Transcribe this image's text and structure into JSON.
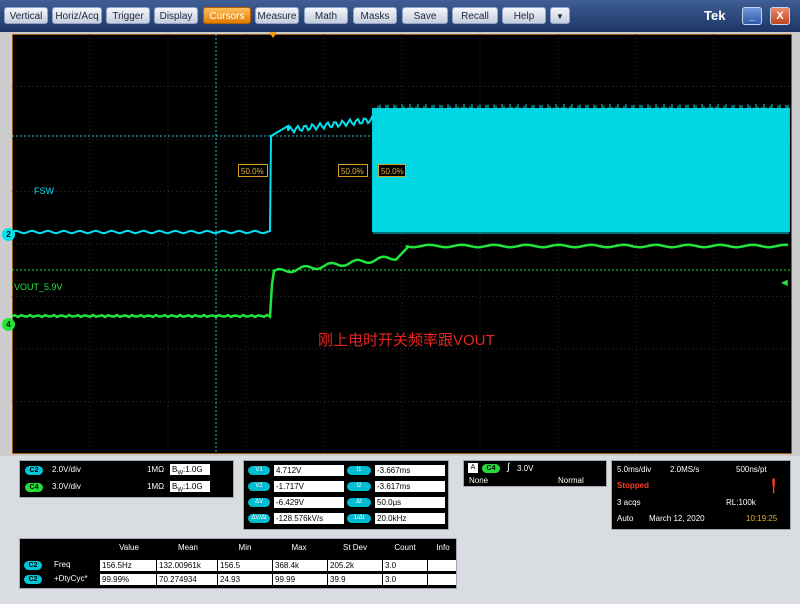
{
  "menu": {
    "items": [
      "Vertical",
      "Horiz/Acq",
      "Trigger",
      "Display",
      "Cursors",
      "Measure",
      "Math",
      "Masks",
      "Save",
      "Recall",
      "Help"
    ],
    "active": "Cursors",
    "dropdown_glyph": "▼",
    "brand": "Tek",
    "minimize_glyph": "_",
    "close_glyph": "X"
  },
  "scope": {
    "title": "刚上电时开关频率跟VOUT",
    "channels": {
      "fsw": {
        "label": "FSW",
        "marker": "2",
        "color": "#00e2ee"
      },
      "vout": {
        "label": "VOUT_5.9V",
        "marker": "4",
        "color": "#22e53c"
      }
    },
    "cursor_readouts": [
      "50.0%",
      "50.0%",
      "50.0%"
    ]
  },
  "channel_settings": {
    "rows": [
      {
        "badge": "C2",
        "scale": "2.0V/div",
        "impedance": "1MΩ",
        "bw_b": "B",
        "bw_sub": "W",
        "bw_value": ":1.0G"
      },
      {
        "badge": "C4",
        "scale": "3.0V/div",
        "impedance": "1MΩ",
        "bw_b": "B",
        "bw_sub": "W",
        "bw_value": ":1.0G"
      }
    ]
  },
  "cursors": {
    "left": [
      {
        "label": "V1",
        "value": "4.712V"
      },
      {
        "label": "V2",
        "value": "-1.717V"
      },
      {
        "label": "ΔV",
        "value": "-6.429V"
      },
      {
        "label": "ΔV/Δt",
        "value": "-128.576kV/s"
      }
    ],
    "right": [
      {
        "label": "t1",
        "value": "-3.667ms"
      },
      {
        "label": "t2",
        "value": "-3.617ms"
      },
      {
        "label": "Δt",
        "value": "50.0µs"
      },
      {
        "label": "1/Δt",
        "value": "20.0kHz"
      }
    ]
  },
  "trigger": {
    "source_badge": "A",
    "channel_badge": "C4",
    "slope_glyph": "∫",
    "level": "3.0V",
    "coupling": "None",
    "mode": "Normal"
  },
  "timebase": {
    "scale": "5.0ms/div",
    "sample_rate": "2.0MS/s",
    "resolution": "500ns/pt",
    "state": "Stopped",
    "state_color": "#ff3b1f",
    "acqs": "3 acqs",
    "record_length": "RL:100k",
    "mode": "Auto",
    "date": "March 12, 2020",
    "time": "10:19:25"
  },
  "measurements": {
    "headers": [
      "Value",
      "Mean",
      "Min",
      "Max",
      "St Dev",
      "Count",
      "Info"
    ],
    "rows": [
      {
        "badge": "C2",
        "name": "Freq",
        "cells": [
          "156.5Hz",
          "132.00961k",
          "156.5",
          "368.4k",
          "205.2k",
          "3.0",
          ""
        ]
      },
      {
        "badge": "C2",
        "name": "+DtyCyc*",
        "cells": [
          "99.99%",
          "70.274934",
          "24.93",
          "99.99",
          "39.9",
          "3.0",
          ""
        ]
      }
    ]
  }
}
